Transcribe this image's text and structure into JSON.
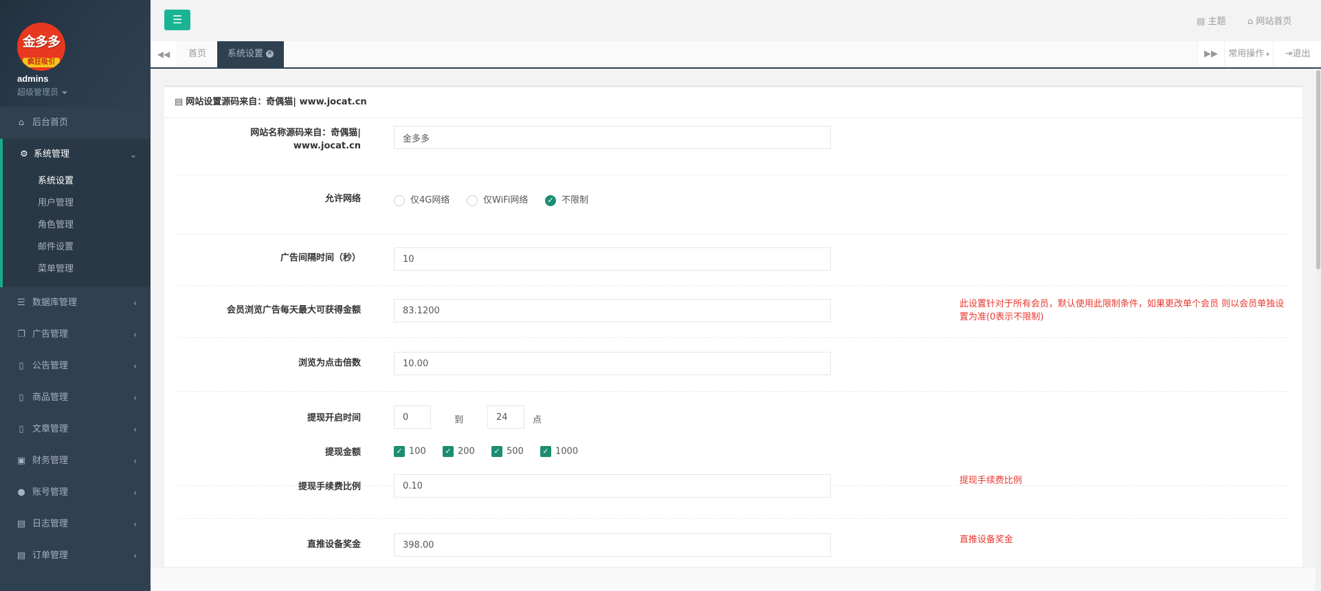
{
  "user": {
    "logo_text": "金多多",
    "logo_sub": "疯狂吸引",
    "name": "admins",
    "role": "超级管理员"
  },
  "sidebar": {
    "home": {
      "label": "后台首页",
      "icon": "home-icon"
    },
    "system": {
      "label": "系统管理",
      "items": [
        "系统设置",
        "用户管理",
        "角色管理",
        "邮件设置",
        "菜单管理"
      ]
    },
    "menus": [
      {
        "label": "数据库管理",
        "icon": "database-icon"
      },
      {
        "label": "广告管理",
        "icon": "copy-icon"
      },
      {
        "label": "公告管理",
        "icon": "file-icon"
      },
      {
        "label": "商品管理",
        "icon": "file-icon"
      },
      {
        "label": "文章管理",
        "icon": "file-icon"
      },
      {
        "label": "财务管理",
        "icon": "money-icon"
      },
      {
        "label": "账号管理",
        "icon": "user-icon"
      },
      {
        "label": "日志管理",
        "icon": "list-icon"
      },
      {
        "label": "订单管理",
        "icon": "list-icon"
      }
    ]
  },
  "topbar": {
    "theme": "主题",
    "site_home": "网站首页"
  },
  "tabs": {
    "home": "首页",
    "current": "系统设置",
    "common_ops": "常用操作",
    "logout": "退出"
  },
  "panel": {
    "title": "网站设置源码来自：奇偶猫| www.jocat.cn"
  },
  "form": {
    "site_name": {
      "label1": "网站名称源码来自：奇偶猫|",
      "label2": "www.jocat.cn",
      "value": "金多多"
    },
    "network": {
      "label": "允许网络",
      "options": [
        "仅4G网络",
        "仅WiFi网络",
        "不限制"
      ],
      "selected": "不限制"
    },
    "ad_interval": {
      "label": "广告间隔时间（秒）",
      "value": "10"
    },
    "max_earn": {
      "label": "会员浏览广告每天最大可获得金额",
      "value": "83.1200",
      "note1": "此设置针对于所有会员，默认使用此限制条件，如果更改单个会员 则以会员单独设",
      "note2": "置为准(0表示不限制)"
    },
    "click_ratio": {
      "label": "浏览为点击倍数",
      "value": "10.00"
    },
    "withdraw_time": {
      "label": "提现开启时间",
      "from": "0",
      "to_word": "到",
      "to": "24",
      "unit": "点"
    },
    "withdraw_amount": {
      "label": "提现金额",
      "options": [
        "100",
        "200",
        "500",
        "1000"
      ]
    },
    "withdraw_fee": {
      "label": "提现手续费比例",
      "value": "0.10",
      "note": "提现手续费比例"
    },
    "device_bonus": {
      "label": "直推设备奖金",
      "value": "398.00",
      "note": "直推设备奖金"
    }
  }
}
